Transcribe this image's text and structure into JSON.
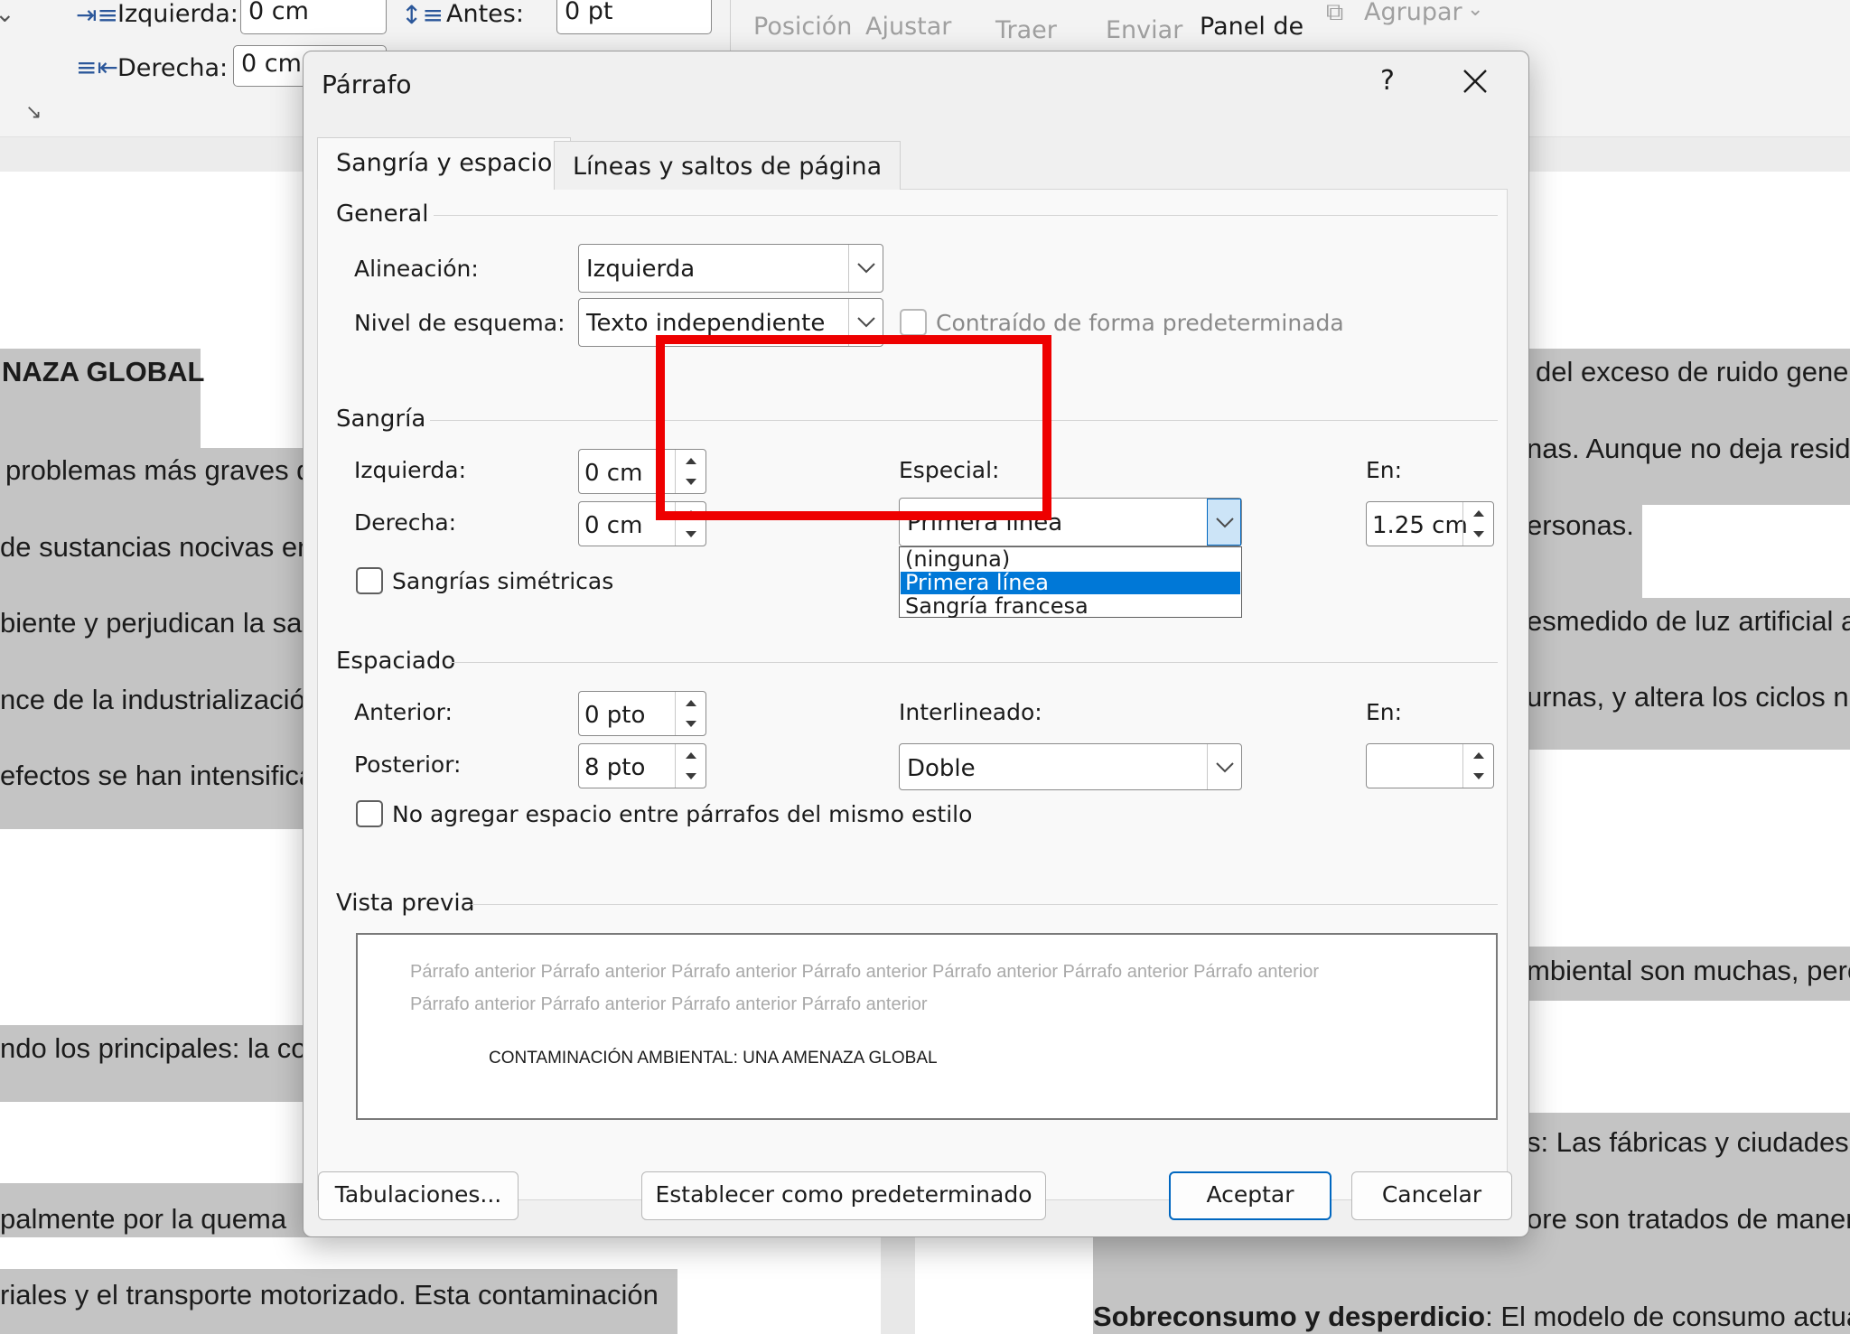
{
  "ribbon": {
    "left_indent_label": "Izquierda:",
    "left_indent_value": "0 cm",
    "right_indent_label": "Derecha:",
    "right_indent_value": "0 cm",
    "before_label": "Antes:",
    "before_value": "0 pt",
    "arrange": {
      "position": "Posición",
      "wrap": "Ajustar",
      "bring": "Traer",
      "send": "Enviar",
      "panel": "Panel de",
      "group": "Agrupar"
    }
  },
  "document": {
    "left_lines": [
      "NAZA GLOBAL",
      "problemas más graves d",
      "de sustancias nocivas en",
      "biente y perjudican la sa",
      "nce de la industrialización",
      "efectos se han intensifica",
      "ndo los principales: la co",
      "palmente por la quema",
      "riales y el transporte motorizado. Esta contaminación"
    ],
    "right_lines": [
      "del exceso de ruido gener",
      "nas. Aunque no deja resid",
      "ersonas.",
      "esmedido de luz artificial a",
      "urnas, y altera los ciclos na",
      "mbiental son muchas, pero",
      "s: Las fábricas y ciudades g",
      "ore son tratados de manera"
    ],
    "last_line_bold": "Sobreconsumo y desperdicio",
    "last_line_rest": ": El modelo de consumo actual"
  },
  "dialog": {
    "title": "Párrafo",
    "help": "?",
    "tabs": [
      {
        "label": "Sangría y espacio",
        "selected": true
      },
      {
        "label": "Líneas y saltos de página",
        "selected": false
      }
    ],
    "general": {
      "heading": "General",
      "alignment_label": "Alineación:",
      "alignment_value": "Izquierda",
      "outline_label": "Nivel de esquema:",
      "outline_value": "Texto independiente",
      "collapsed_label": "Contraído de forma predeterminada",
      "collapsed_checked": false
    },
    "indent": {
      "heading": "Sangría",
      "left_label": "Izquierda:",
      "left_value": "0 cm",
      "right_label": "Derecha:",
      "right_value": "0 cm",
      "mirror_label": "Sangrías simétricas",
      "mirror_checked": false,
      "special_label": "Especial:",
      "special_value": "Primera línea",
      "special_options": [
        "(ninguna)",
        "Primera línea",
        "Sangría francesa"
      ],
      "special_selected_index": 1,
      "by_label": "En:",
      "by_value": "1.25 cm"
    },
    "spacing": {
      "heading": "Espaciado",
      "before_label": "Anterior:",
      "before_value": "0 pto",
      "after_label": "Posterior:",
      "after_value": "8 pto",
      "line_spacing_label": "Interlineado:",
      "line_spacing_value": "Doble",
      "at_label": "En:",
      "at_value": "",
      "no_space_label": "No agregar espacio entre párrafos del mismo estilo",
      "no_space_checked": false
    },
    "preview": {
      "heading": "Vista previa",
      "previous_line_1": "Párrafo anterior Párrafo anterior Párrafo anterior Párrafo anterior Párrafo anterior Párrafo anterior Párrafo anterior",
      "previous_line_2": "Párrafo anterior Párrafo anterior Párrafo anterior Párrafo anterior",
      "sample": "CONTAMINACIÓN AMBIENTAL: UNA AMENAZA GLOBAL"
    },
    "buttons": {
      "tabs": "Tabulaciones...",
      "set_default": "Establecer como predeterminado",
      "ok": "Aceptar",
      "cancel": "Cancelar"
    },
    "highlight_color": "#ee0000",
    "selection_color": "#0078d7"
  }
}
